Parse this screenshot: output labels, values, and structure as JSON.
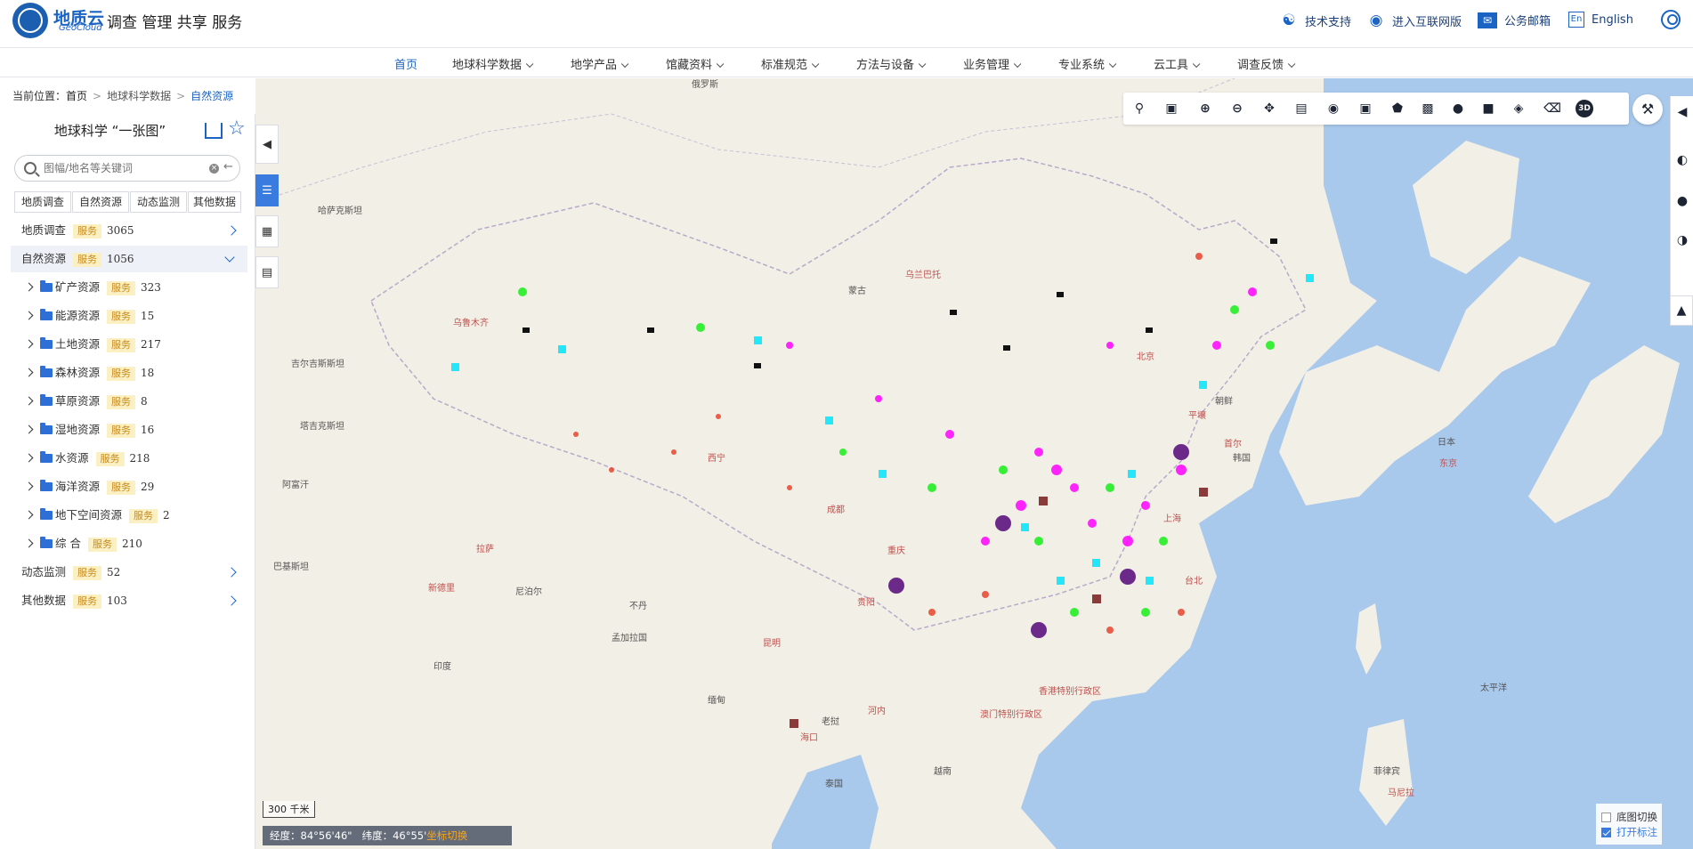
{
  "header": {
    "logo_cn": "地质云",
    "logo_en": "GeoCloud",
    "slogan": "调查 管理 共享 服务",
    "links": [
      {
        "label": "技术支持",
        "icon": "headset-icon"
      },
      {
        "label": "进入互联网版",
        "icon": "globe-icon"
      },
      {
        "label": "公务邮箱",
        "icon": "mail-icon"
      },
      {
        "label": "English",
        "icon": "en-icon"
      }
    ]
  },
  "nav": {
    "items": [
      {
        "label": "首页",
        "caret": false,
        "active": true
      },
      {
        "label": "地球科学数据",
        "caret": true
      },
      {
        "label": "地学产品",
        "caret": true
      },
      {
        "label": "馆藏资料",
        "caret": true
      },
      {
        "label": "标准规范",
        "caret": true
      },
      {
        "label": "方法与设备",
        "caret": true
      },
      {
        "label": "业务管理",
        "caret": true
      },
      {
        "label": "专业系统",
        "caret": true
      },
      {
        "label": "云工具",
        "caret": true
      },
      {
        "label": "调查反馈",
        "caret": true
      }
    ]
  },
  "breadcrumb": {
    "prefix": "当前位置：",
    "items": [
      "首页",
      "地球科学数据",
      "自然资源"
    ]
  },
  "panel": {
    "title": "地球科学 “一张图”",
    "search_placeholder": "图幅/地名等关键词",
    "tabs": [
      "地质调查",
      "自然资源",
      "动态监测",
      "其他数据"
    ],
    "badge": "服务",
    "categories": [
      {
        "label": "地质调查",
        "count": "3065",
        "expanded": false
      },
      {
        "label": "自然资源",
        "count": "1056",
        "expanded": true
      }
    ],
    "children": [
      {
        "label": "矿产资源",
        "count": "323"
      },
      {
        "label": "能源资源",
        "count": "15"
      },
      {
        "label": "土地资源",
        "count": "217"
      },
      {
        "label": "森林资源",
        "count": "18"
      },
      {
        "label": "草原资源",
        "count": "8"
      },
      {
        "label": "湿地资源",
        "count": "16"
      },
      {
        "label": "水资源",
        "count": "218"
      },
      {
        "label": "海洋资源",
        "count": "29"
      },
      {
        "label": "地下空间资源",
        "count": "2"
      },
      {
        "label": "综 合",
        "count": "210"
      }
    ],
    "more_categories": [
      {
        "label": "动态监测",
        "count": "52"
      },
      {
        "label": "其他数据",
        "count": "103"
      }
    ]
  },
  "map": {
    "scale": "300 千米",
    "coord_lon": "经度：84°56'46\"",
    "coord_lat": "纬度：46°55'",
    "coord_switch": "坐标切换",
    "layer_switch": "底图切换",
    "show_labels": "打开标注",
    "labels": [
      {
        "text": "俄罗斯",
        "red": false
      },
      {
        "text": "蒙古",
        "red": false
      },
      {
        "text": "乌兰巴托",
        "red": true
      },
      {
        "text": "哈萨克斯坦",
        "red": false
      },
      {
        "text": "吉尔吉斯斯坦",
        "red": false
      },
      {
        "text": "塔吉克斯坦",
        "red": false
      },
      {
        "text": "阿富汗",
        "red": false
      },
      {
        "text": "巴基斯坦",
        "red": false
      },
      {
        "text": "印度",
        "red": false
      },
      {
        "text": "新德里",
        "red": true
      },
      {
        "text": "尼泊尔",
        "red": false
      },
      {
        "text": "不丹",
        "red": false
      },
      {
        "text": "孟加拉国",
        "red": false
      },
      {
        "text": "缅甸",
        "red": false
      },
      {
        "text": "老挝",
        "red": false
      },
      {
        "text": "河内",
        "red": true
      },
      {
        "text": "泰国",
        "red": false
      },
      {
        "text": "越南",
        "red": false
      },
      {
        "text": "朝鲜",
        "red": false
      },
      {
        "text": "平壤",
        "red": true
      },
      {
        "text": "韩国",
        "red": false
      },
      {
        "text": "首尔",
        "red": true
      },
      {
        "text": "日本",
        "red": false
      },
      {
        "text": "东京",
        "red": true
      },
      {
        "text": "太平洋",
        "red": false
      },
      {
        "text": "菲律宾",
        "red": false
      },
      {
        "text": "马尼拉",
        "red": true
      },
      {
        "text": "北京",
        "red": true
      },
      {
        "text": "上海",
        "red": true
      },
      {
        "text": "台北",
        "red": true
      },
      {
        "text": "乌鲁木齐",
        "red": true
      },
      {
        "text": "拉萨",
        "red": true
      },
      {
        "text": "西宁",
        "red": true
      },
      {
        "text": "成都",
        "red": true
      },
      {
        "text": "重庆",
        "red": true
      },
      {
        "text": "贵阳",
        "red": true
      },
      {
        "text": "昆明",
        "red": true
      },
      {
        "text": "海口",
        "red": true
      },
      {
        "text": "香港特别行政区",
        "red": true
      },
      {
        "text": "澳门特别行政区",
        "red": true
      }
    ]
  }
}
